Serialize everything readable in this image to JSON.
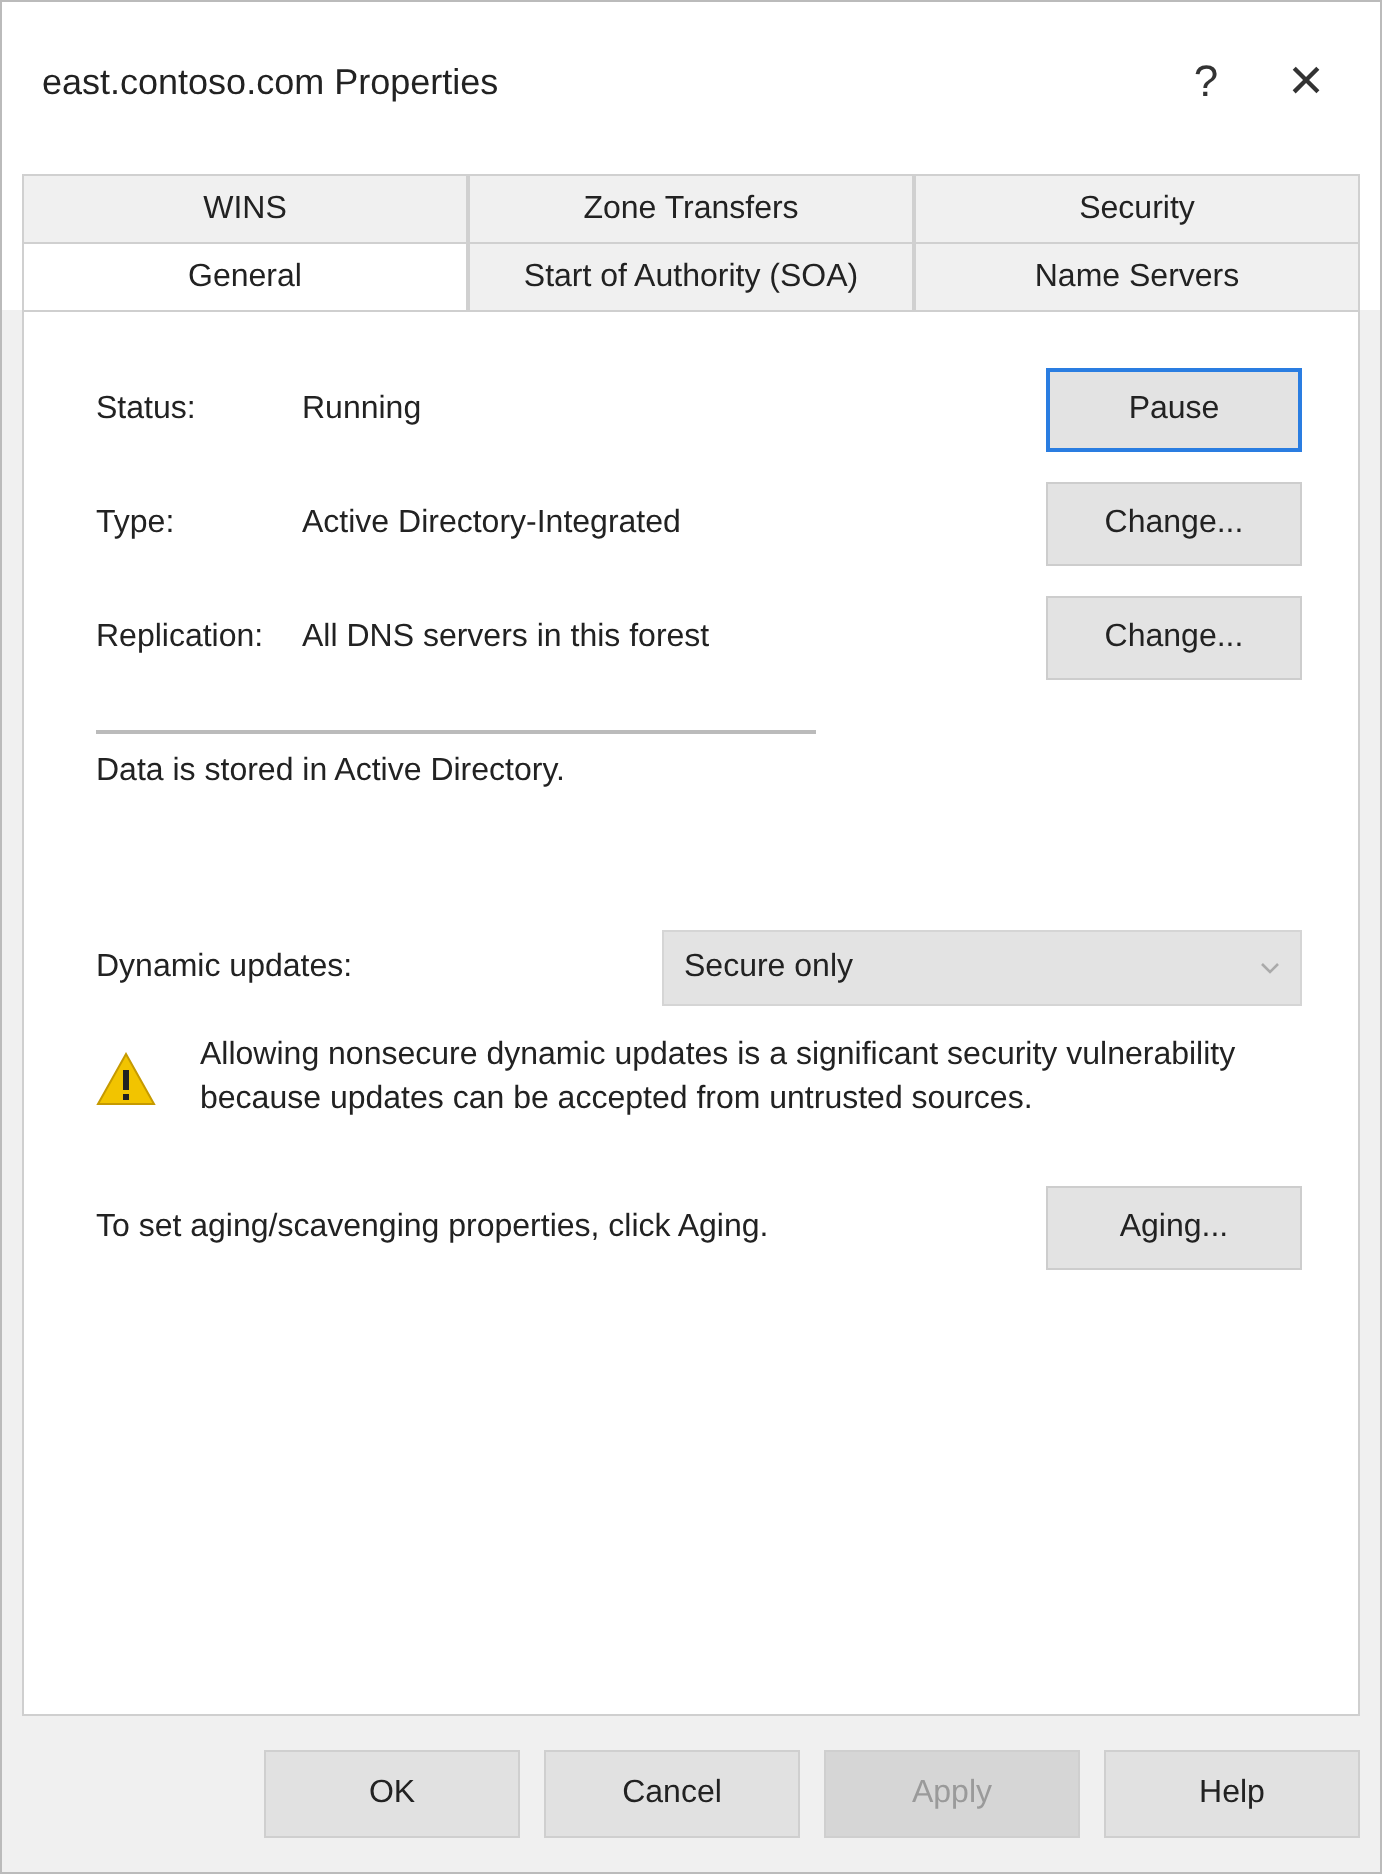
{
  "window": {
    "title": "east.contoso.com Properties",
    "help": "?",
    "close": "×"
  },
  "tab_rows": [
    [
      {
        "label": "WINS",
        "selected": false
      },
      {
        "label": "Zone Transfers",
        "selected": false
      },
      {
        "label": "Security",
        "selected": false
      }
    ],
    [
      {
        "label": "General",
        "selected": true
      },
      {
        "label": "Start of Authority (SOA)",
        "selected": false
      },
      {
        "label": "Name Servers",
        "selected": false
      }
    ]
  ],
  "properties": [
    {
      "label": "Status:",
      "value": "Running",
      "button": {
        "label": "Pause",
        "focused": true
      }
    },
    {
      "label": "Type:",
      "value": "Active Directory-Integrated",
      "button": {
        "label": "Change...",
        "focused": false
      }
    },
    {
      "label": "Replication:",
      "value": "All DNS servers in this forest",
      "button": {
        "label": "Change...",
        "focused": false
      }
    }
  ],
  "storage_note": "Data is stored in Active Directory.",
  "dynamic_updates": {
    "label": "Dynamic updates:",
    "value": "Secure only"
  },
  "warning": "Allowing nonsecure dynamic updates is a significant security vulnerability because updates can be accepted from untrusted sources.",
  "aging": {
    "text": "To set aging/scavenging properties, click Aging.",
    "button": "Aging..."
  },
  "buttons": [
    {
      "label": "OK",
      "disabled": false
    },
    {
      "label": "Cancel",
      "disabled": false
    },
    {
      "label": "Apply",
      "disabled": true
    },
    {
      "label": "Help",
      "disabled": false
    }
  ]
}
